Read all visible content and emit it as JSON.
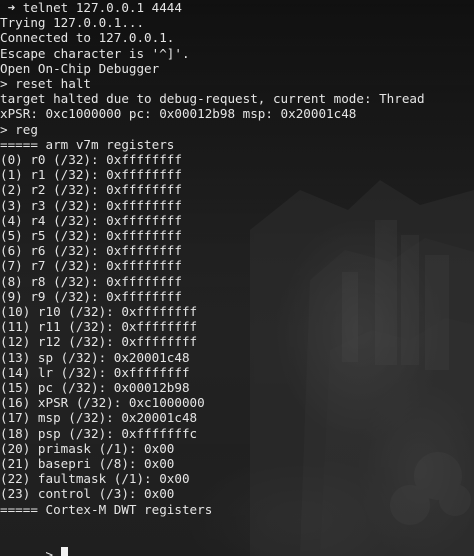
{
  "terminal": {
    "lines": [
      " ➜ telnet 127.0.0.1 4444",
      "Trying 127.0.0.1...",
      "Connected to 127.0.0.1.",
      "Escape character is '^]'.",
      "Open On-Chip Debugger",
      "> reset halt",
      "target halted due to debug-request, current mode: Thread",
      "xPSR: 0xc1000000 pc: 0x00012b98 msp: 0x20001c48",
      "> reg",
      "===== arm v7m registers",
      "(0) r0 (/32): 0xffffffff",
      "(1) r1 (/32): 0xffffffff",
      "(2) r2 (/32): 0xffffffff",
      "(3) r3 (/32): 0xffffffff",
      "(4) r4 (/32): 0xffffffff",
      "(5) r5 (/32): 0xffffffff",
      "(6) r6 (/32): 0xffffffff",
      "(7) r7 (/32): 0xffffffff",
      "(8) r8 (/32): 0xffffffff",
      "(9) r9 (/32): 0xffffffff",
      "(10) r10 (/32): 0xffffffff",
      "(11) r11 (/32): 0xffffffff",
      "(12) r12 (/32): 0xffffffff",
      "(13) sp (/32): 0x20001c48",
      "(14) lr (/32): 0xffffffff",
      "(15) pc (/32): 0x00012b98",
      "(16) xPSR (/32): 0xc1000000",
      "(17) msp (/32): 0x20001c48",
      "(18) psp (/32): 0xfffffffc",
      "(20) primask (/1): 0x00",
      "(21) basepri (/8): 0x00",
      "(22) faultmask (/1): 0x00",
      "(23) control (/3): 0x00",
      "===== Cortex-M DWT registers",
      "",
      "> "
    ]
  }
}
